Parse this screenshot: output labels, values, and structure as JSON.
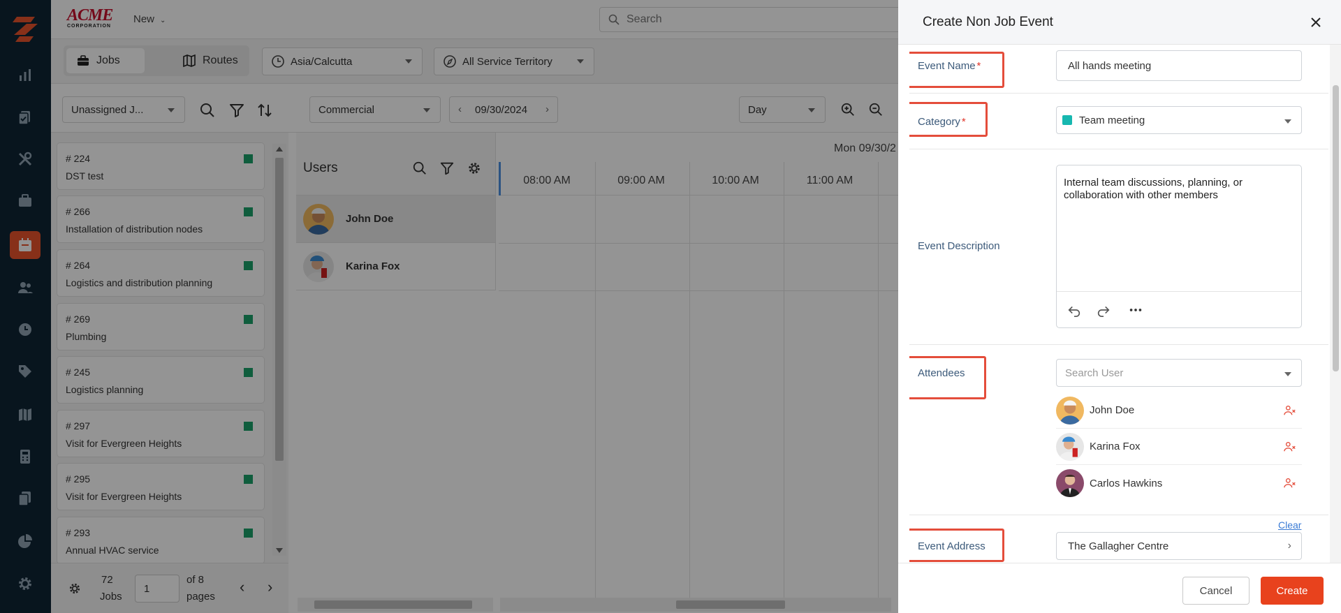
{
  "header": {
    "brand_top": "ACME",
    "brand_bottom": "CORPORATION",
    "new_label": "New",
    "search_placeholder": "Search"
  },
  "toolbar": {
    "tabs": [
      {
        "label": "Jobs"
      },
      {
        "label": "Routes"
      }
    ],
    "timezone": "Asia/Calcutta",
    "territory": "All Service Territory"
  },
  "filters": {
    "job_filter": "Unassigned J...",
    "business_type": "Commercial",
    "date": "09/30/2024",
    "view": "Day"
  },
  "jobs": [
    {
      "number": "# 224",
      "title": "DST test"
    },
    {
      "number": "# 266",
      "title": "Installation of distribution nodes"
    },
    {
      "number": "# 264",
      "title": "Logistics and distribution planning"
    },
    {
      "number": "# 269",
      "title": "Plumbing"
    },
    {
      "number": "# 245",
      "title": "Logistics planning"
    },
    {
      "number": "# 297",
      "title": "Visit for Evergreen Heights"
    },
    {
      "number": "# 295",
      "title": "Visit for Evergreen Heights"
    },
    {
      "number": "# 293",
      "title": "Annual HVAC service"
    }
  ],
  "pager": {
    "count": "72",
    "count_label": "Jobs",
    "page_value": "1",
    "of_label": "of 8",
    "pages_label": "pages"
  },
  "scheduler": {
    "users_title": "Users",
    "date_header": "Mon 09/30/2",
    "hours": [
      "08:00 AM",
      "09:00 AM",
      "10:00 AM",
      "11:00 AM"
    ],
    "users": [
      {
        "name": "John Doe"
      },
      {
        "name": "Karina Fox"
      }
    ]
  },
  "modal": {
    "title": "Create Non Job Event",
    "event_name_label": "Event Name",
    "event_name_value": "All hands meeting",
    "required_mark": "*",
    "category_label": "Category",
    "category_value": "Team meeting",
    "category_color": "#17b8b0",
    "description_label": "Event Description",
    "description_value": "Internal team discussions, planning, or collaboration with other members",
    "attendees_label": "Attendees",
    "attendees_placeholder": "Search User",
    "attendees": [
      {
        "name": "John Doe"
      },
      {
        "name": "Karina Fox"
      },
      {
        "name": "Carlos Hawkins"
      }
    ],
    "clear_label": "Clear",
    "address_label": "Event Address",
    "address_value": "The Gallagher Centre",
    "cancel_label": "Cancel",
    "create_label": "Create"
  },
  "colors": {
    "accent": "#e8542c",
    "rail_bg": "#0e2535",
    "job_status": "#1aa06a",
    "highlight": "#e44d3b"
  }
}
